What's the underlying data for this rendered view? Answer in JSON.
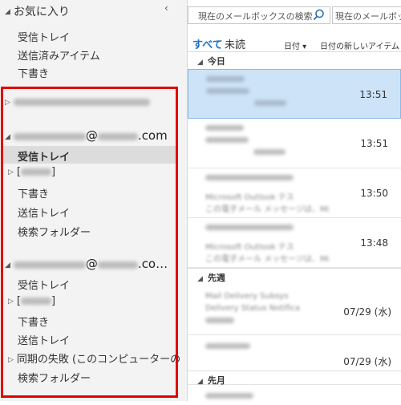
{
  "favorites": {
    "header": "お気に入り",
    "collapse_icon": "chevron-left-icon",
    "items": [
      "受信トレイ",
      "送信済みアイテム",
      "下書き"
    ]
  },
  "accounts": [
    {
      "email_visible": "@",
      "email_suffix": ".com",
      "folders": [
        "受信トレイ",
        "[",
        "]",
        "下書き",
        "送信トレイ",
        "検索フォルダー"
      ]
    },
    {
      "email_visible": "@",
      "email_suffix": ".co…",
      "folders": [
        "受信トレイ",
        "[",
        "]",
        "下書き",
        "送信トレイ",
        "同期の失敗 (このコンピューターのみ)",
        "検索フォルダー"
      ]
    }
  ],
  "search": {
    "placeholder": "現在のメールボックスの検索",
    "scope": "現在のメールボックス"
  },
  "filters": {
    "all": "すべて",
    "unread": "未読",
    "sort_by": "日付 ▾",
    "sort_order": "日付の新しいアイテム ↓"
  },
  "groups": {
    "today": "今日",
    "last_week": "先週",
    "last_month": "先月"
  },
  "messages": [
    {
      "time": "13:51",
      "selected": true
    },
    {
      "time": "13:51",
      "selected": false
    },
    {
      "time": "13:50",
      "selected": false,
      "line2": "Microsoft Outlook テス",
      "line3": "この電子メール メッセージは、Mi"
    },
    {
      "time": "13:48",
      "selected": false,
      "line2": "Microsoft Outlook テス",
      "line3": "この電子メール メッセージは、Mi"
    },
    {
      "date": "07/29 (水)",
      "selected": false,
      "line1": "Mail Delivery Subsys",
      "line2": "Delivery Status Notifica"
    },
    {
      "date": "07/29 (水)",
      "selected": false
    }
  ],
  "colors": {
    "accent": "#1e6fc8",
    "highlight": "#e00000",
    "selected_row": "#cde3f7"
  }
}
